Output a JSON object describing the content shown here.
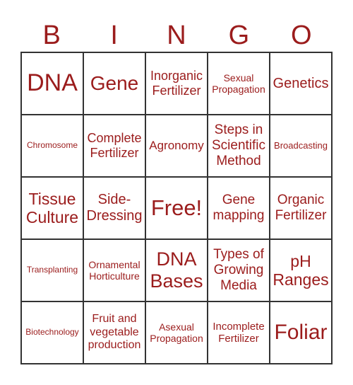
{
  "header": [
    "B",
    "I",
    "N",
    "G",
    "O"
  ],
  "color": "#9b1c1c",
  "cells": [
    "DNA",
    "Gene",
    "Inorganic Fertilizer",
    "Sexual Propagation",
    "Genetics",
    "Chromosome",
    "Complete Fertilizer",
    "Agronomy",
    "Steps in Scientific Method",
    "Broadcasting",
    "Tissue Culture",
    "Side-Dressing",
    "Free!",
    "Gene mapping",
    "Organic Fertilizer",
    "Transplanting",
    "Ornamental Horticulture",
    "DNA Bases",
    "Types of Growing Media",
    "pH Ranges",
    "Biotechnology",
    "Fruit and vegetable production",
    "Asexual Propagation",
    "Incomplete Fertilizer",
    "Foliar"
  ]
}
